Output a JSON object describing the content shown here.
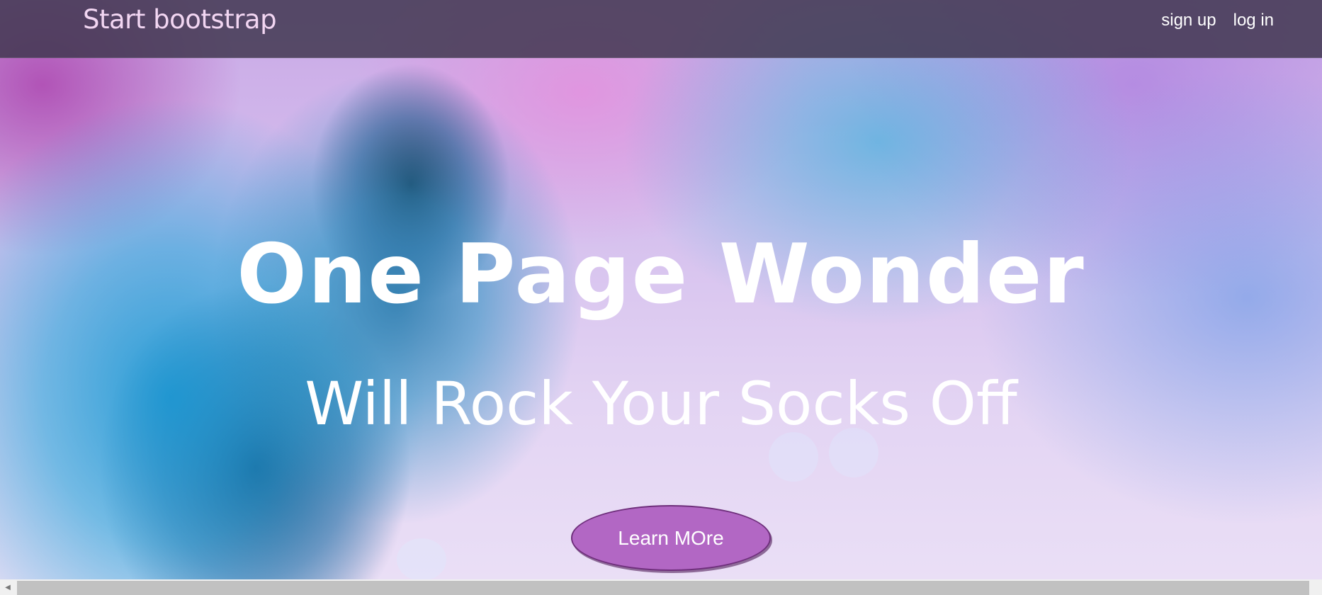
{
  "navbar": {
    "brand": "Start bootstrap",
    "links": [
      {
        "label": "sign up"
      },
      {
        "label": "log in"
      }
    ]
  },
  "hero": {
    "headline": "One Page Wonder",
    "subheadline": "Will Rock Your Socks Off",
    "cta_label": "Learn MOre"
  },
  "scrollbar": {
    "left_arrow_icon": "triangle-left-icon",
    "left_arrow_glyph": "◀"
  },
  "colors": {
    "navbar_bg": "#413750",
    "brand_text": "#f2d6f2",
    "cta_bg": "#b267c4",
    "cta_border": "#6f2f7c"
  }
}
